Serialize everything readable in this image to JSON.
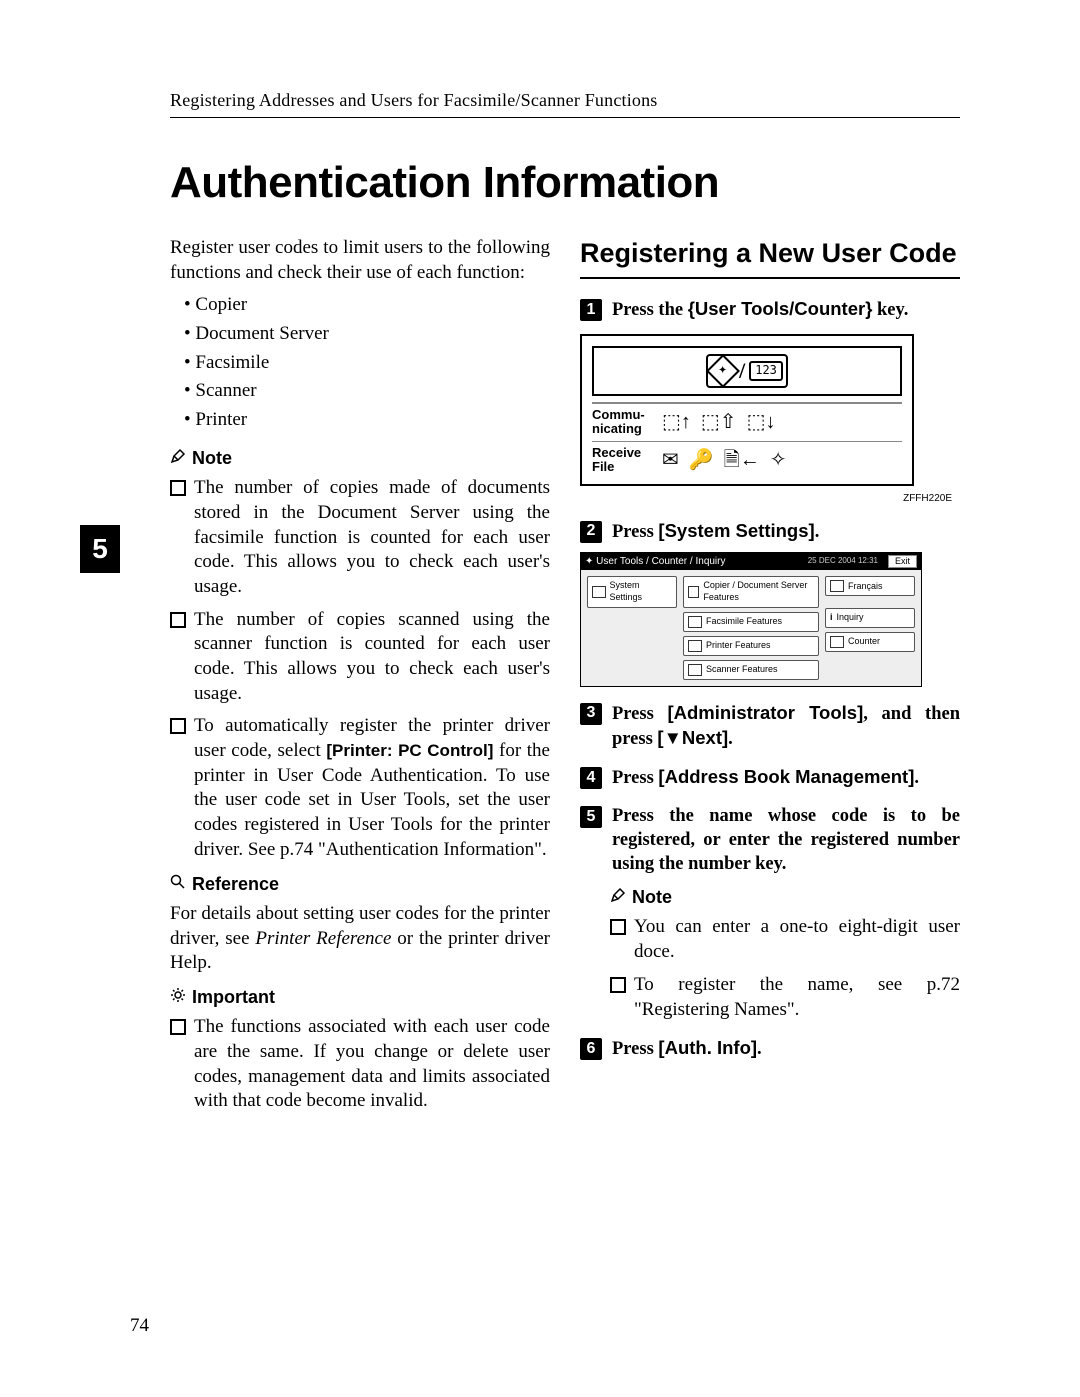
{
  "header": {
    "running": "Registering Addresses and Users for Facsimile/Scanner Functions"
  },
  "title": "Authentication Information",
  "tab": "5",
  "left": {
    "intro": "Register user codes to limit users to the following functions and check their use of each function:",
    "functions": [
      "Copier",
      "Document Server",
      "Facsimile",
      "Scanner",
      "Printer"
    ],
    "noteLabel": "Note",
    "notes": [
      "The number of copies made of documents stored in the Document Server using the facsimile function is counted for each user code. This allows you to check each user's usage.",
      "The number of copies scanned using the scanner function is counted for each user code. This allows you to check each user's usage."
    ],
    "note3_a": "To automatically register the printer driver user code, select ",
    "note3_bold": "[Printer: PC Control]",
    "note3_b": " for the printer in User Code Authentication. To use the user code set in User Tools, set the user codes registered in User Tools for the printer driver. See p.74 \"Authentication Information\".",
    "refLabel": "Reference",
    "ref_a": "For details about setting user codes for the printer driver, see ",
    "ref_it": "Printer Reference",
    "ref_b": " or the printer driver Help.",
    "impLabel": "Important",
    "imp": "The functions associated with each user code are the same. If you change or delete user codes, management data and limits associated with that code become invalid."
  },
  "right": {
    "section": "Registering a New User Code",
    "step1_a": "Press the ",
    "step1_key": "{User Tools/Counter}",
    "step1_b": " key.",
    "panel": {
      "row1": "Communicating",
      "row2": "Receive File"
    },
    "img_code": "ZFFH220E",
    "step2_a": "Press ",
    "step2_bold": "[System Settings]",
    "step2_b": ".",
    "ui": {
      "title": "User Tools / Counter / Inquiry",
      "date": "25 DEC   2004 12:31",
      "exit": "Exit",
      "system": "System Settings",
      "copier": "Copier / Document Server Features",
      "fax": "Facsimile Features",
      "printer": "Printer Features",
      "scanner": "Scanner Features",
      "lang": "Français",
      "inquiry": "Inquiry",
      "counter": "Counter"
    },
    "step3_a": "Press ",
    "step3_bold": "[Administrator Tools]",
    "step3_b": ", and then press ",
    "step3_bold2": "[▼Next]",
    "step3_c": ".",
    "step4_a": "Press ",
    "step4_bold": "[Address Book Management]",
    "step4_b": ".",
    "step5": "Press the name whose code is to be registered, or enter the registered number using the number key.",
    "subNoteLabel": "Note",
    "subNote1": "You can enter a one-to eight-digit user doce.",
    "subNote2": "To register the name, see p.72 \"Registering Names\".",
    "step6_a": "Press ",
    "step6_bold": "[Auth. Info]",
    "step6_b": "."
  },
  "pageNumber": "74",
  "chart_data": null
}
